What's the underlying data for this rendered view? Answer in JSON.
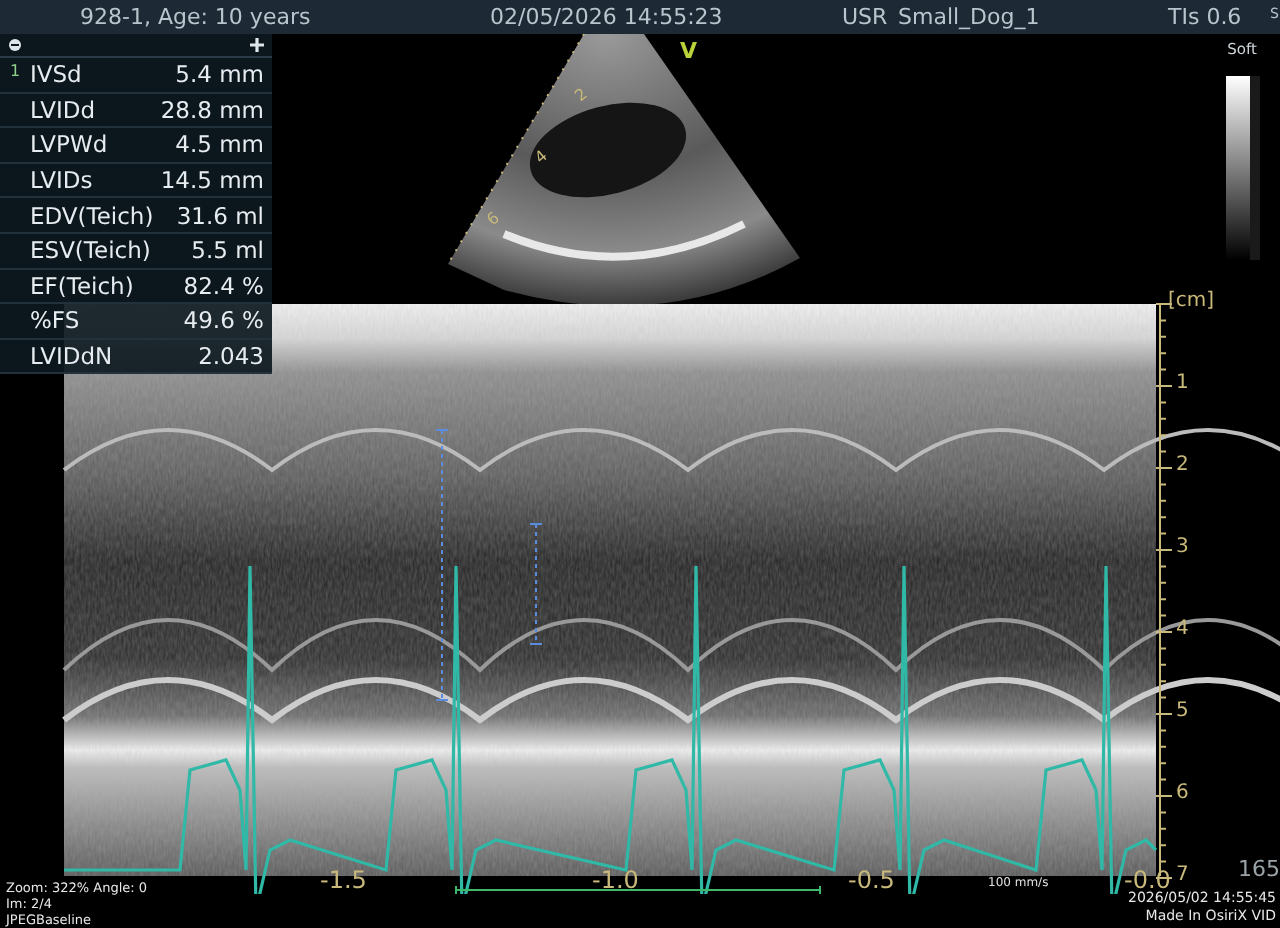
{
  "top_bar": {
    "patient": "928-1, Age: 10 years",
    "datetime": "02/05/2026 14:55:23",
    "preset_label": "USR",
    "preset": "Small_Dog_1",
    "tis": "TIs 0.6",
    "corner_mark": "S"
  },
  "measurements": {
    "marker": "1",
    "rows": [
      {
        "name": "IVSd",
        "value": "5.4 mm"
      },
      {
        "name": "LVIDd",
        "value": "28.8 mm"
      },
      {
        "name": "LVPWd",
        "value": "4.5 mm"
      },
      {
        "name": "LVIDs",
        "value": "14.5 mm"
      },
      {
        "name": "EDV(Teich)",
        "value": "31.6 ml"
      },
      {
        "name": "ESV(Teich)",
        "value": "5.5 ml"
      },
      {
        "name": "EF(Teich)",
        "value": "82.4 %"
      },
      {
        "name": "%FS",
        "value": "49.6 %"
      },
      {
        "name": "LVIDdN",
        "value": "2.043"
      }
    ]
  },
  "sector": {
    "mark": "V",
    "depth_labels": [
      "2",
      "4",
      "6"
    ]
  },
  "grayscale": {
    "label": "Soft"
  },
  "mmode": {
    "depth_unit": "[cm]",
    "depth_labels": [
      "1",
      "2",
      "3",
      "4",
      "5",
      "6",
      "7"
    ],
    "time_labels": [
      "-1.5",
      "-1.0",
      "-0.5",
      "-0.0"
    ],
    "sweep": "100 mm/s",
    "heart_rate": "165"
  },
  "footer": {
    "info": [
      "Zoom: 322% Angle: 0",
      "Im: 2/4",
      "JPEGBaseline"
    ],
    "stamp": [
      "2026/05/02 14:55:45",
      "Made In OsiriX VID"
    ]
  }
}
